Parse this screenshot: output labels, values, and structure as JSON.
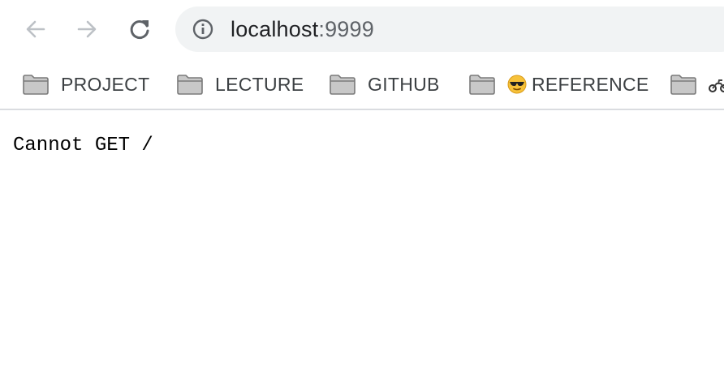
{
  "toolbar": {
    "back_icon": "arrow-left-icon",
    "forward_icon": "arrow-right-icon",
    "reload_icon": "reload-icon",
    "omnibox": {
      "site_info_icon": "info-icon",
      "host": "localhost",
      "port": ":9999"
    }
  },
  "bookmarks": [
    {
      "icon": "folder-icon",
      "label": "PROJECT"
    },
    {
      "icon": "folder-icon",
      "label": "LECTURE"
    },
    {
      "icon": "folder-icon",
      "label": "GITHUB"
    },
    {
      "icon": "folder-icon",
      "emoji": "sunglasses-face-emoji",
      "label": "REFERENCE"
    },
    {
      "icon": "folder-icon",
      "emoji": "motorcycle-emoji",
      "label": ""
    }
  ],
  "page": {
    "body_text": "Cannot GET /"
  },
  "colors": {
    "omnibox_bg": "#f1f3f4",
    "bar_border": "#dadce0",
    "folder_fill": "#c8c8c8",
    "folder_stroke": "#7a7a7a",
    "icon_disabled": "#bdc1c6",
    "icon_active": "#5f6368"
  }
}
